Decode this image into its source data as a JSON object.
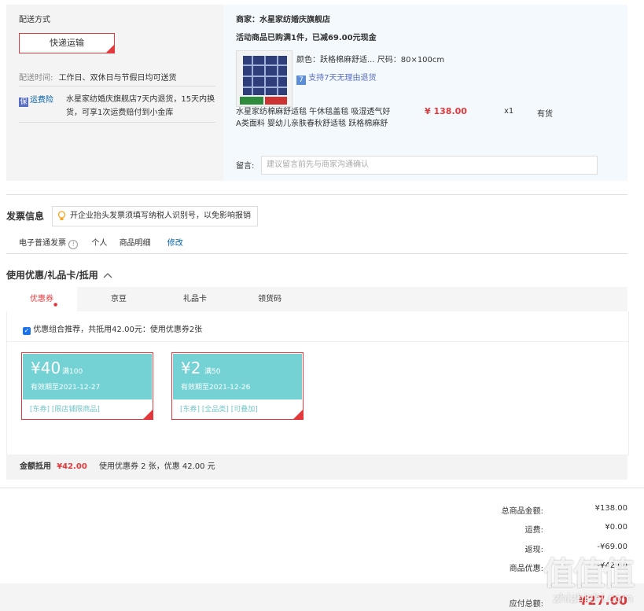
{
  "shipping": {
    "title": "配送方式",
    "method": "快递运输",
    "time_label": "配送时间:",
    "time_value": "工作日、双休日与节假日均可送货",
    "insurance_label": "运费险",
    "insurance_text_1": "水星家纺婚庆旗舰店7天内退货，15天内换",
    "insurance_text_2": "货，可享1次运费赔付到小金库"
  },
  "store": {
    "merchant": "商家：水星家纺婚庆旗舰店",
    "promo": "活动商品已购满1件，已减69.00元现金",
    "spec": "颜色：跃格棉麻舒适... 尺码：80×100cm",
    "return_policy": "支持7天无理由退货",
    "product_name_1": "水星家纺棉麻舒适毯 午休毯盖毯 吸湿透气好",
    "product_name_2": "A类面料 婴幼儿亲肤春秋舒适毯 跃格棉麻舒",
    "price": "¥ 138.00",
    "qty": "x1",
    "stock": "有货",
    "remark_label": "留言:",
    "remark_placeholder": "建议留言前先与商家沟通确认"
  },
  "invoice": {
    "title": "发票信息",
    "tip": "开企业抬头发票须填写纳税人识别号，以免影响报销",
    "type": "电子普通发票",
    "title_type": "个人",
    "content": "商品明细",
    "edit": "修改"
  },
  "discount": {
    "title": "使用优惠/礼品卡/抵用",
    "tabs": [
      "优惠券",
      "京豆",
      "礼品卡",
      "领货码"
    ],
    "recommend": "优惠组合推荐，共抵用42.00元：使用优惠券2张",
    "coupons": [
      {
        "amount": "¥40",
        "condition": "满100",
        "expiry": "有效期至2021-12-27",
        "tags": "[东券] [限店铺限商品]"
      },
      {
        "amount": "¥2",
        "condition": "满50",
        "expiry": "有效期至2021-12-26",
        "tags": "[东券] [全品类] [可叠加]"
      }
    ],
    "summary_label": "金额抵用",
    "summary_amount": "¥42.00",
    "summary_text": "使用优惠券 2 张，优惠 42.00 元"
  },
  "totals": {
    "rows": [
      {
        "label": "总商品金额:",
        "value": "¥138.00"
      },
      {
        "label": "运费:",
        "value": "¥0.00"
      },
      {
        "label": "返现:",
        "value": "-¥69.00"
      },
      {
        "label": "商品优惠:",
        "value": "-¥42.00"
      }
    ],
    "payable_label": "应付总额:",
    "payable_value": "¥27.00"
  },
  "watermark": {
    "text": "值值值",
    "url": "zhizhizhi.com"
  },
  "colors": {
    "accent": "#e4393c",
    "coupon": "#74d2d4",
    "link": "#005ea7"
  }
}
